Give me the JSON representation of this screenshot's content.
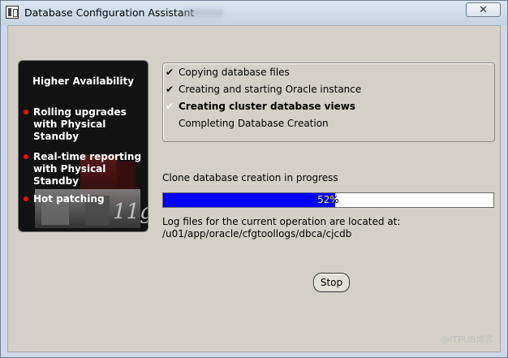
{
  "window": {
    "title": "Database Configuration Assistant",
    "close_glyph": "✕"
  },
  "promo": {
    "heading": "Higher Availability",
    "items": [
      {
        "label": "Rolling upgrades with Physical Standby"
      },
      {
        "label": "Real-time reporting with Physical Standby"
      },
      {
        "label": "Hot patching"
      }
    ],
    "logo_text": "11g"
  },
  "steps": [
    {
      "label": "Copying database files",
      "status": "done",
      "mark": "✔"
    },
    {
      "label": "Creating and starting Oracle instance",
      "status": "done",
      "mark": "✔"
    },
    {
      "label": "Creating cluster database views",
      "status": "active",
      "mark": "✔"
    },
    {
      "label": "Completing Database Creation",
      "status": "pending",
      "mark": ""
    }
  ],
  "progress": {
    "status_text": "Clone database creation in progress",
    "percent": 52,
    "percent_label": "52%",
    "fill_color": "#0000ff"
  },
  "log": {
    "line1": "Log files for the current operation are located at:",
    "path": "/u01/app/oracle/cfgtoollogs/dbca/cjcdb"
  },
  "buttons": {
    "stop": "Stop"
  },
  "watermark": "@ITPUB博客"
}
